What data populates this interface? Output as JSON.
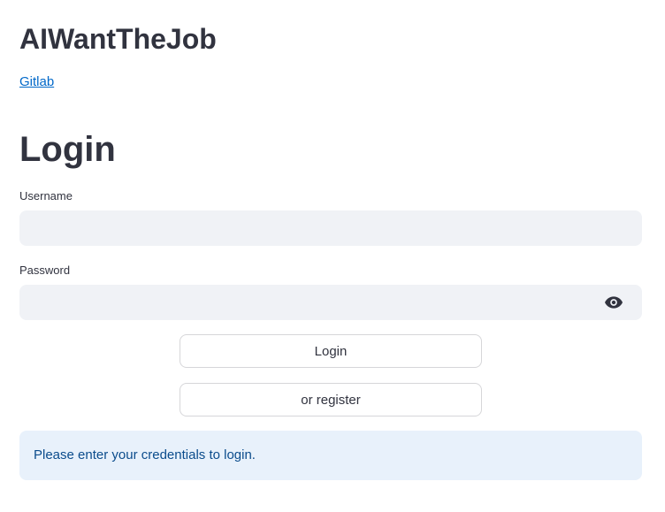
{
  "app": {
    "title": "AIWantTheJob",
    "link_label": "Gitlab"
  },
  "form": {
    "heading": "Login",
    "username": {
      "label": "Username",
      "value": "",
      "placeholder": ""
    },
    "password": {
      "label": "Password",
      "value": "",
      "placeholder": "",
      "toggle_icon": "eye-icon"
    },
    "login_button": "Login",
    "register_button": "or register"
  },
  "info": {
    "message": "Please enter your credentials to login."
  },
  "colors": {
    "text": "#31333f",
    "link": "#0068c9",
    "input_bg": "#f0f2f6",
    "info_bg": "#e8f1fb",
    "info_text": "#0b4c8c",
    "button_border": "#d6d6d9"
  }
}
